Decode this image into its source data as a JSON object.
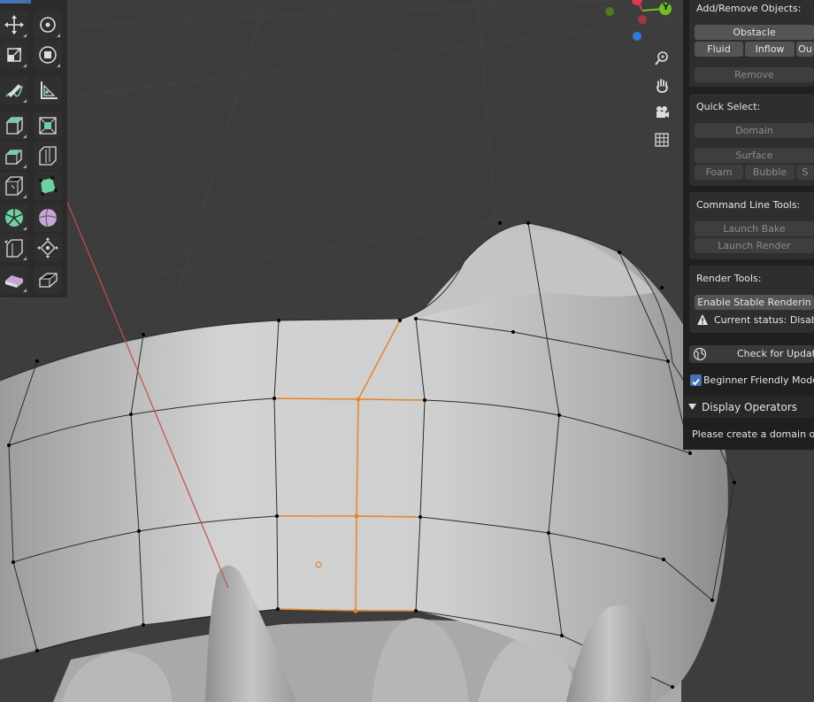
{
  "panel": {
    "add_remove": {
      "title": "Add/Remove Objects:",
      "obstacle": "Obstacle",
      "fluid": "Fluid",
      "inflow": "Inflow",
      "outflow": "Ou",
      "remove": "Remove"
    },
    "quick_select": {
      "title": "Quick Select:",
      "domain": "Domain",
      "surface": "Surface",
      "foam": "Foam",
      "bubble": "Bubble",
      "spray": "S"
    },
    "command_line": {
      "title": "Command Line Tools:",
      "launch_bake": "Launch Bake",
      "launch_render": "Launch Render"
    },
    "render_tools": {
      "title": "Render Tools:",
      "enable_stable": "Enable Stable Renderin",
      "status": "Current status: Disable"
    },
    "check_updates": "Check for Update",
    "beginner_mode": {
      "label": "Beginner Friendly Mode",
      "checked": true
    },
    "display_operators": {
      "title": "Display Operators",
      "message": "Please create a domain obje"
    }
  },
  "gizmo": {
    "y_label": "Y",
    "colors": {
      "x": "#e0394c",
      "y": "#6fbf26",
      "z": "#2f7be0"
    }
  },
  "toolbar": {
    "tools": [
      "move-icon",
      "rotate-icon",
      "scale-icon",
      "transform-icon",
      "annotate-icon",
      "measure-icon",
      "add-cube-icon",
      "extrude-icon",
      "inset-icon",
      "bevel-icon",
      "loop-cut-icon",
      "offset-edge-icon",
      "knife-icon",
      "poly-build-icon",
      "spin-icon",
      "smooth-icon",
      "edge-slide-icon",
      "shrink-fatten-icon",
      "shear-icon",
      "rip-icon"
    ]
  },
  "colors": {
    "accent": "#4772b3",
    "selection": "#e8852a",
    "background": "#3d3d3d"
  }
}
